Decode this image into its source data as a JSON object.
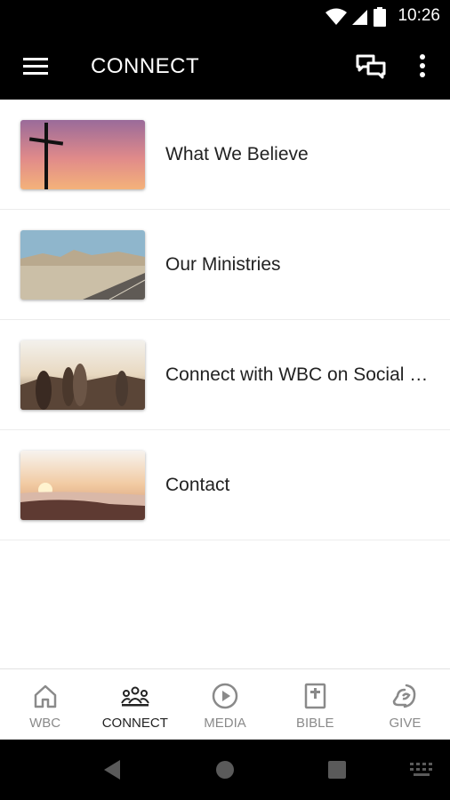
{
  "status": {
    "time": "10:26"
  },
  "header": {
    "title": "CONNECT"
  },
  "items": [
    {
      "label": "What We Believe"
    },
    {
      "label": "Our Ministries"
    },
    {
      "label": "Connect with WBC on Social Media"
    },
    {
      "label": "Contact"
    }
  ],
  "nav": [
    {
      "label": "WBC",
      "icon": "home-icon"
    },
    {
      "label": "CONNECT",
      "icon": "people-icon"
    },
    {
      "label": "MEDIA",
      "icon": "play-icon"
    },
    {
      "label": "BIBLE",
      "icon": "bible-icon"
    },
    {
      "label": "GIVE",
      "icon": "give-icon"
    }
  ],
  "colors": {
    "bar": "#000000",
    "active": "#222222",
    "inactive": "#8a8a8a"
  }
}
